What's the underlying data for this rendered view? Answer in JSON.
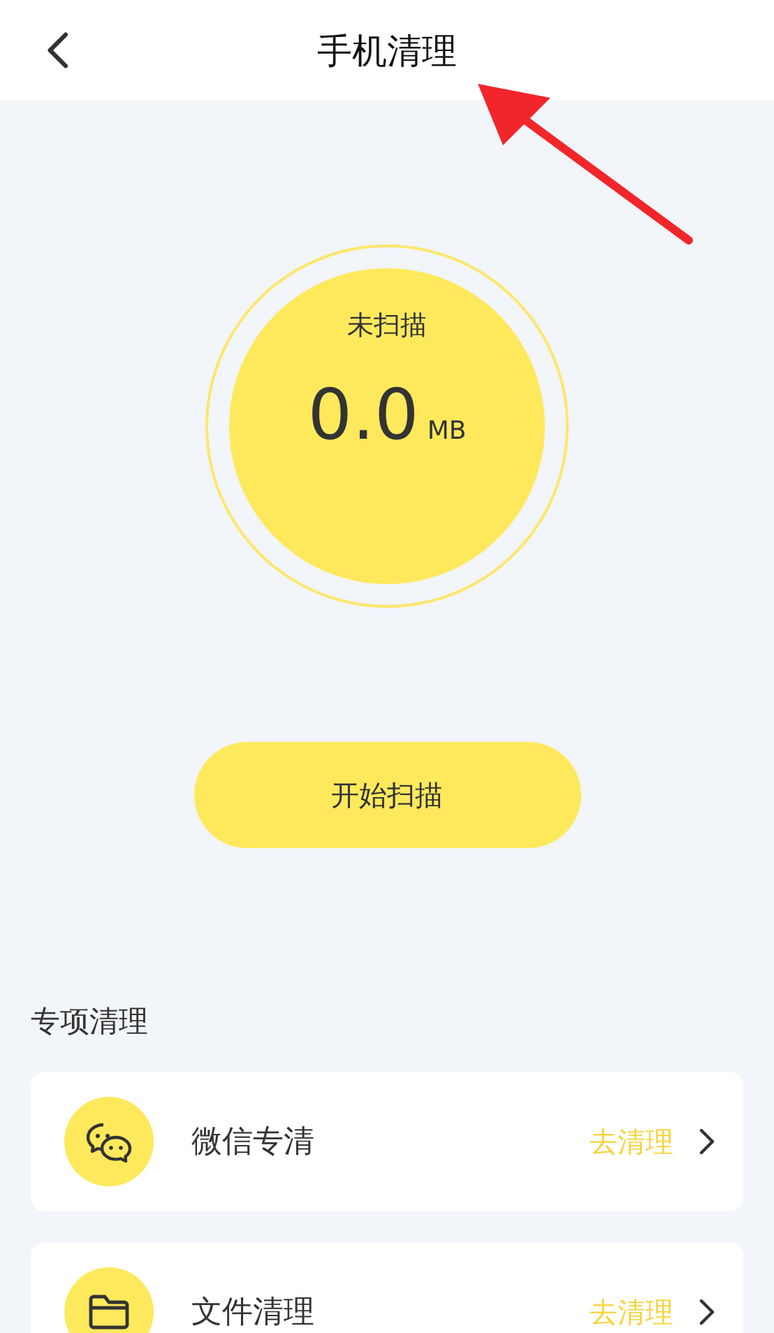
{
  "header": {
    "title": "手机清理"
  },
  "annotation": {
    "kind": "arrow"
  },
  "scan": {
    "status": "未扫描",
    "size": "0.0",
    "unit": "MB"
  },
  "scan_button": "开始扫描",
  "section": {
    "title": "专项清理",
    "items": [
      {
        "kind": "chat",
        "name": "微信专清",
        "action": "去清理"
      },
      {
        "kind": "folder",
        "name": "文件清理",
        "action": "去清理"
      }
    ]
  }
}
